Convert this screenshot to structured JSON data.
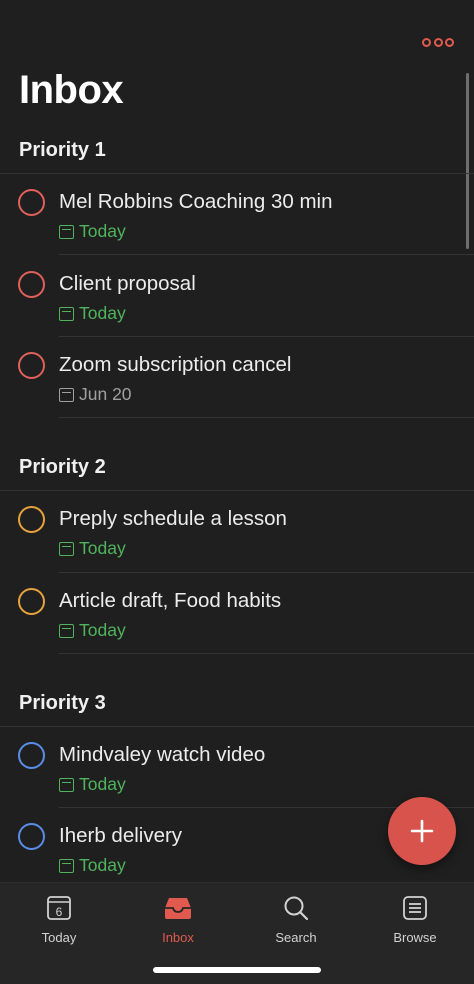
{
  "header": {
    "title": "Inbox",
    "more_icon": "ellipsis-icon"
  },
  "colors": {
    "accent": "#e05a4f",
    "priority1": "#e0605a",
    "priority2": "#e8a23c",
    "priority3": "#5a8de8",
    "today_green": "#4fb45b",
    "date_gray": "#a0a0a0"
  },
  "sections": [
    {
      "label": "Priority 1",
      "tasks": [
        {
          "title": "Mel Robbins Coaching 30 min",
          "due": "Today"
        },
        {
          "title": "Client proposal",
          "due": "Today"
        },
        {
          "title": "Zoom subscription cancel",
          "due": "Jun 20"
        }
      ]
    },
    {
      "label": "Priority 2",
      "tasks": [
        {
          "title": "Preply schedule a lesson",
          "due": "Today"
        },
        {
          "title": "Article draft, Food habits",
          "due": "Today"
        }
      ]
    },
    {
      "label": "Priority 3",
      "tasks": [
        {
          "title": "Mindvaley watch video",
          "due": "Today"
        },
        {
          "title": "Iherb delivery",
          "due": "Today"
        }
      ]
    }
  ],
  "tabbar": {
    "items": [
      {
        "label": "Today",
        "icon": "calendar-icon",
        "calendar_day": "6"
      },
      {
        "label": "Inbox",
        "icon": "inbox-icon"
      },
      {
        "label": "Search",
        "icon": "search-icon"
      },
      {
        "label": "Browse",
        "icon": "list-icon"
      }
    ],
    "active": "Inbox"
  },
  "fab": {
    "icon": "plus-icon"
  }
}
